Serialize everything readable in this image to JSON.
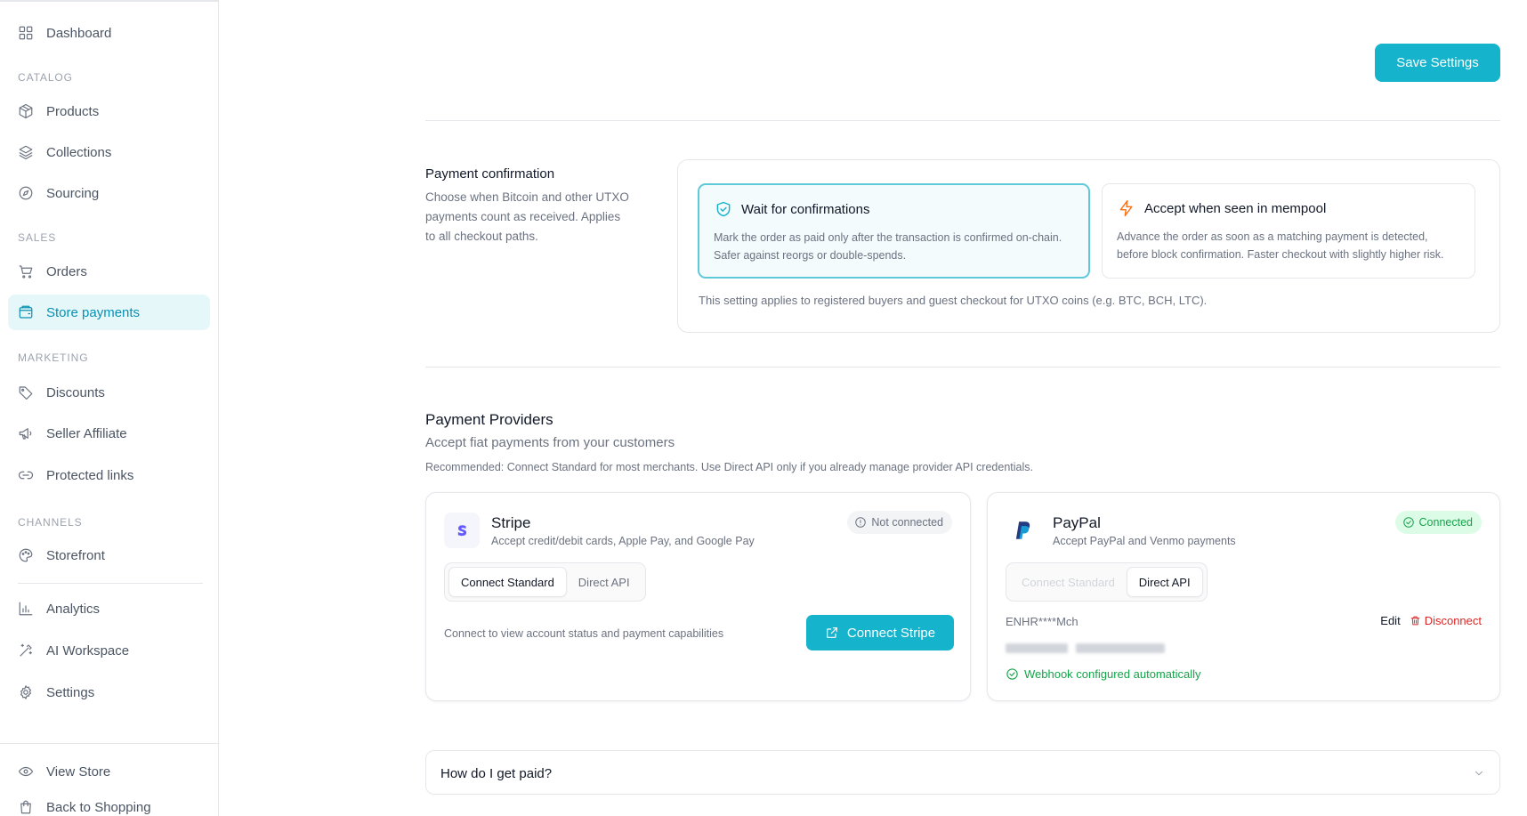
{
  "sidebar": {
    "dashboard": "Dashboard",
    "sections": {
      "catalog": "CATALOG",
      "sales": "SALES",
      "marketing": "MARKETING",
      "channels": "CHANNELS"
    },
    "items": {
      "products": "Products",
      "collections": "Collections",
      "sourcing": "Sourcing",
      "orders": "Orders",
      "store_payments": "Store payments",
      "discounts": "Discounts",
      "seller_affiliate": "Seller Affiliate",
      "protected_links": "Protected links",
      "storefront": "Storefront",
      "analytics": "Analytics",
      "ai_workspace": "AI Workspace",
      "settings": "Settings",
      "view_store": "View Store",
      "back_to_shopping": "Back to Shopping"
    }
  },
  "header": {
    "save_label": "Save Settings"
  },
  "payment_confirmation": {
    "title": "Payment confirmation",
    "description": "Choose when Bitcoin and other UTXO payments count as received. Applies to all checkout paths.",
    "options": [
      {
        "label": "Wait for confirmations",
        "description": "Mark the order as paid only after the transaction is confirmed on-chain. Safer against reorgs or double-spends.",
        "selected": true
      },
      {
        "label": "Accept when seen in mempool",
        "description": "Advance the order as soon as a matching payment is detected, before block confirmation. Faster checkout with slightly higher risk.",
        "selected": false
      }
    ],
    "note": "This setting applies to registered buyers and guest checkout for UTXO coins (e.g. BTC, BCH, LTC)."
  },
  "payment_providers": {
    "title": "Payment Providers",
    "subtitle": "Accept fiat payments from your customers",
    "recommendation": "Recommended: Connect Standard for most merchants. Use Direct API only if you already manage provider API credentials.",
    "stripe": {
      "name": "Stripe",
      "description": "Accept credit/debit cards, Apple Pay, and Google Pay",
      "status": "Not connected",
      "mode_standard": "Connect Standard",
      "mode_direct": "Direct API",
      "hint": "Connect to view account status and payment capabilities",
      "connect_label": "Connect Stripe"
    },
    "paypal": {
      "name": "PayPal",
      "description": "Accept PayPal and Venmo payments",
      "status": "Connected",
      "mode_standard": "Connect Standard",
      "mode_direct": "Direct API",
      "client_id": "ENHR****Mch",
      "edit_label": "Edit",
      "disconnect_label": "Disconnect",
      "webhook_status": "Webhook configured automatically"
    }
  },
  "faq": {
    "question": "How do I get paid?"
  },
  "colors": {
    "accent": "#16b3cc",
    "success": "#16a34a",
    "danger": "#dc2626",
    "warning": "#f97316"
  }
}
